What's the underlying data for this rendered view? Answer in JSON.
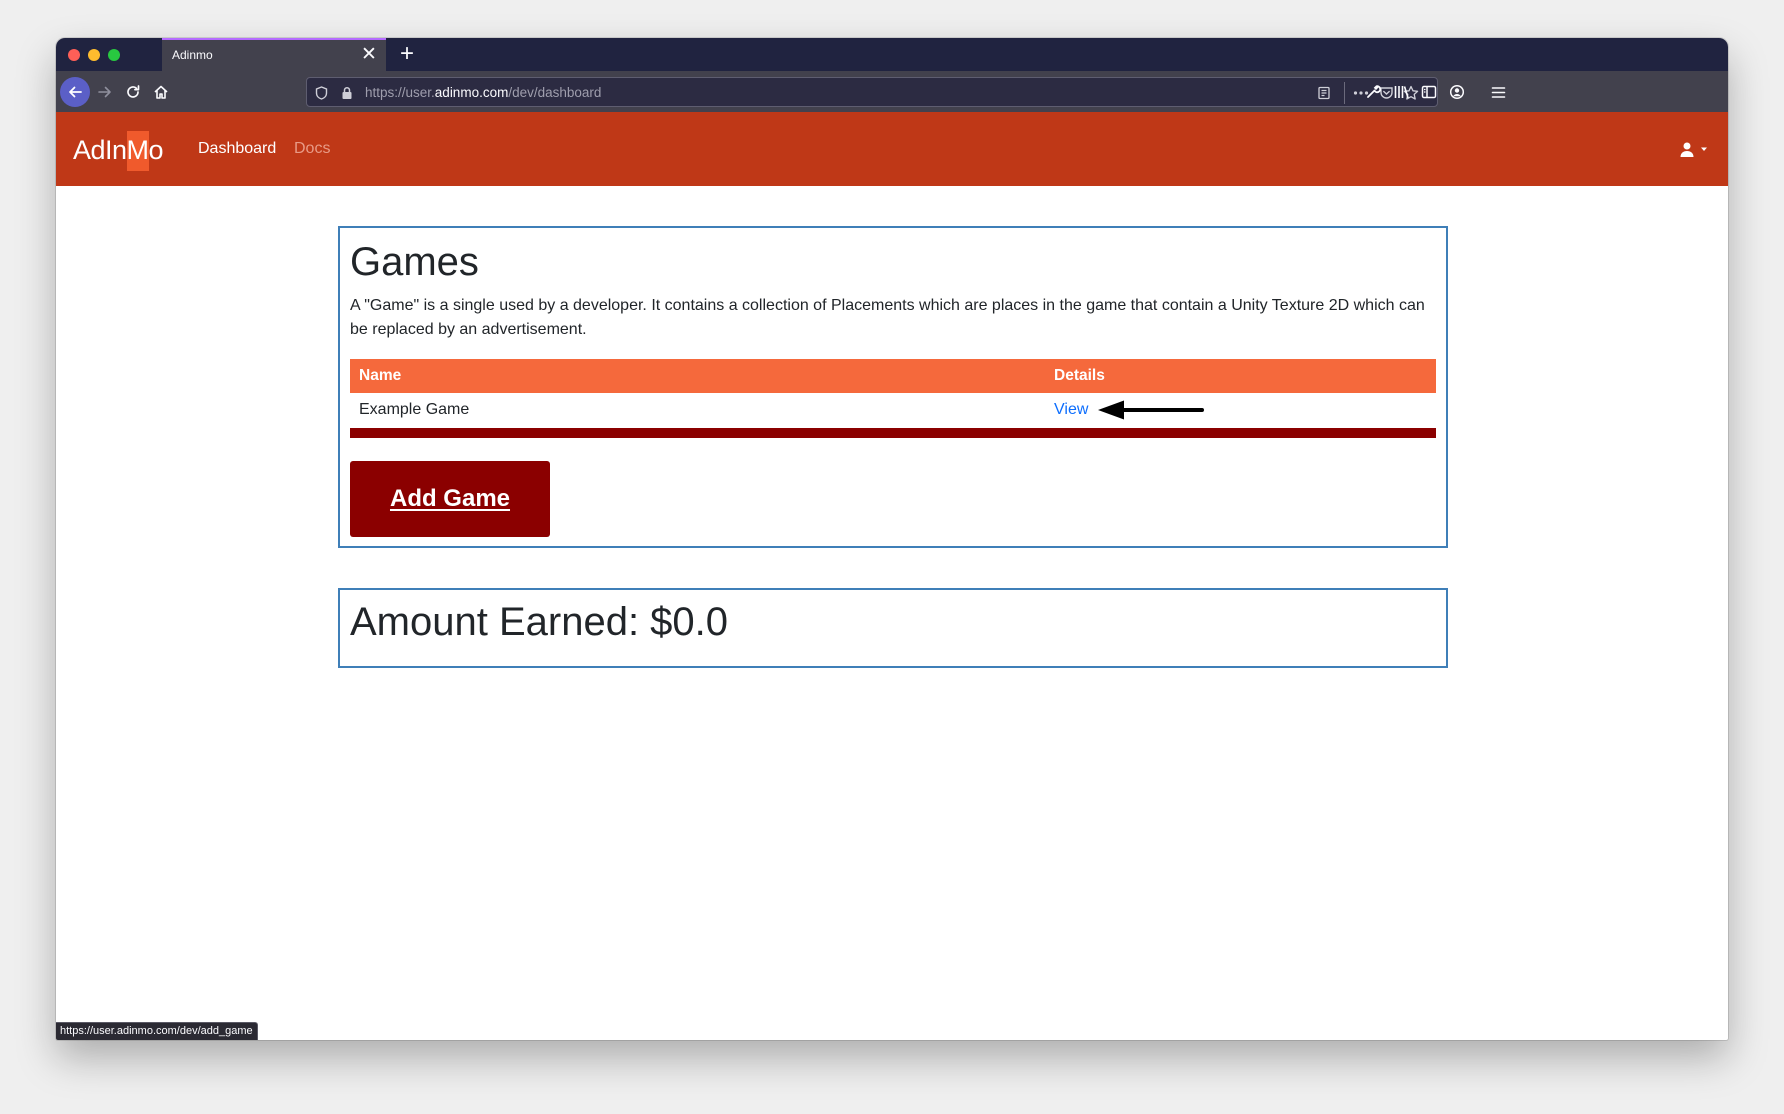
{
  "browser": {
    "tab_title": "Adinmo",
    "tab_close_glyph": "✕",
    "new_tab_glyph": "+",
    "url_prefix": "https://user.",
    "url_domain": "adinmo.com",
    "url_path": "/dev/dashboard",
    "status_url": "https://user.adinmo.com/dev/add_game",
    "icons": [
      "back-arrow-icon",
      "forward-arrow-icon",
      "reload-icon",
      "home-icon",
      "shield-icon",
      "lock-icon",
      "reader-view-icon",
      "more-actions-icon",
      "pocket-icon",
      "bookmark-star-icon",
      "wrench-icon",
      "library-icon",
      "sidebar-icon",
      "account-icon",
      "menu-icon"
    ]
  },
  "header": {
    "logo_left": "AdIn",
    "logo_mid": "M",
    "logo_right": "o",
    "nav": {
      "dashboard": "Dashboard",
      "docs": "Docs"
    },
    "colors": {
      "header_bg": "#bf3817",
      "logo_accent": "#f05a2c",
      "nav_inactive": "#e89a86"
    }
  },
  "games": {
    "title": "Games",
    "description": "A \"Game\" is a single used by a developer. It contains a collection of Placements which are places in the game that contain a Unity Texture 2D which can be replaced by an advertisement.",
    "table": {
      "headers": {
        "name": "Name",
        "details": "Details"
      },
      "rows": [
        {
          "name": "Example Game",
          "details_link": "View"
        }
      ]
    },
    "add_button": "Add Game",
    "colors": {
      "table_header": "#f5693c",
      "accent_dark": "#8b0000",
      "link": "#0d6efd",
      "card_border": "#3f7fb8"
    }
  },
  "earned": {
    "title": "Amount Earned: $0.0"
  }
}
